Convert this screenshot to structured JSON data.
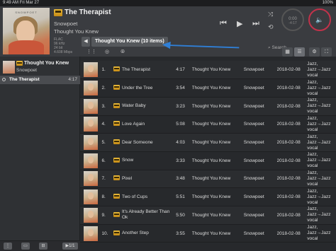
{
  "status": {
    "time": "9:49 AM",
    "date": "Fri Mar 27",
    "right": "100%"
  },
  "now_playing": {
    "title": "The Therapist",
    "artist": "Snowpoet",
    "album": "Thought You Knew",
    "meta": [
      "FLAC",
      "96 kHz",
      "24 bit",
      "4.608 Mbps"
    ],
    "cover_band": "SNOWPOET",
    "timer_top": "0:00",
    "timer_bottom": "-4:17"
  },
  "search": {
    "label": "Search"
  },
  "breadcrumb": {
    "label": "Thought You Knew (10 items)"
  },
  "left": {
    "album_title": "Thought You Knew",
    "album_artist": "Snowpoet",
    "track_name": "The Therapist",
    "track_dur": "4:17",
    "bottom": [
      "⋮",
      "▭",
      "⊟",
      "▶1/1"
    ]
  },
  "tracks": [
    {
      "num": "1.",
      "title": "The Therapist",
      "dur": "4:17",
      "album": "Thought You Knew",
      "artist": "Snowpoet",
      "date": "2018-02-08",
      "genre": "Jazz, Jazz→Jazz vocal"
    },
    {
      "num": "2.",
      "title": "Under the Tree",
      "dur": "3:54",
      "album": "Thought You Knew",
      "artist": "Snowpoet",
      "date": "2018-02-08",
      "genre": "Jazz, Jazz→Jazz vocal"
    },
    {
      "num": "3.",
      "title": "Water Baby",
      "dur": "3:23",
      "album": "Thought You Knew",
      "artist": "Snowpoet",
      "date": "2018-02-08",
      "genre": "Jazz, Jazz→Jazz vocal"
    },
    {
      "num": "4.",
      "title": "Love Again",
      "dur": "5:08",
      "album": "Thought You Knew",
      "artist": "Snowpoet",
      "date": "2018-02-08",
      "genre": "Jazz, Jazz→Jazz vocal"
    },
    {
      "num": "5.",
      "title": "Dear Someone",
      "dur": "4:03",
      "album": "Thought You Knew",
      "artist": "Snowpoet",
      "date": "2018-02-08",
      "genre": "Jazz, Jazz→Jazz vocal"
    },
    {
      "num": "6.",
      "title": "Snow",
      "dur": "3:33",
      "album": "Thought You Knew",
      "artist": "Snowpoet",
      "date": "2018-02-08",
      "genre": "Jazz, Jazz→Jazz vocal"
    },
    {
      "num": "7.",
      "title": "Pixel",
      "dur": "3:48",
      "album": "Thought You Knew",
      "artist": "Snowpoet",
      "date": "2018-02-08",
      "genre": "Jazz, Jazz→Jazz vocal"
    },
    {
      "num": "8.",
      "title": "Two of Cups",
      "dur": "5:51",
      "album": "Thought You Knew",
      "artist": "Snowpoet",
      "date": "2018-02-08",
      "genre": "Jazz, Jazz→Jazz vocal"
    },
    {
      "num": "9.",
      "title": "It's Already Better Than Ok",
      "dur": "5:50",
      "album": "Thought You Knew",
      "artist": "Snowpoet",
      "date": "2018-02-08",
      "genre": "Jazz, Jazz→Jazz vocal"
    },
    {
      "num": "10.",
      "title": "Another Step",
      "dur": "3:55",
      "album": "Thought You Knew",
      "artist": "Snowpoet",
      "date": "2018-02-08",
      "genre": "Jazz, Jazz→Jazz vocal"
    }
  ],
  "colors": {
    "accent": "#c2324a",
    "arrow": "#2f7fd6"
  },
  "icons": {
    "prev": "skip-back-icon",
    "play": "play-icon",
    "next": "skip-forward-icon",
    "shuffle": "shuffle-icon",
    "repeat": "repeat-icon",
    "volume": "volume-icon"
  }
}
